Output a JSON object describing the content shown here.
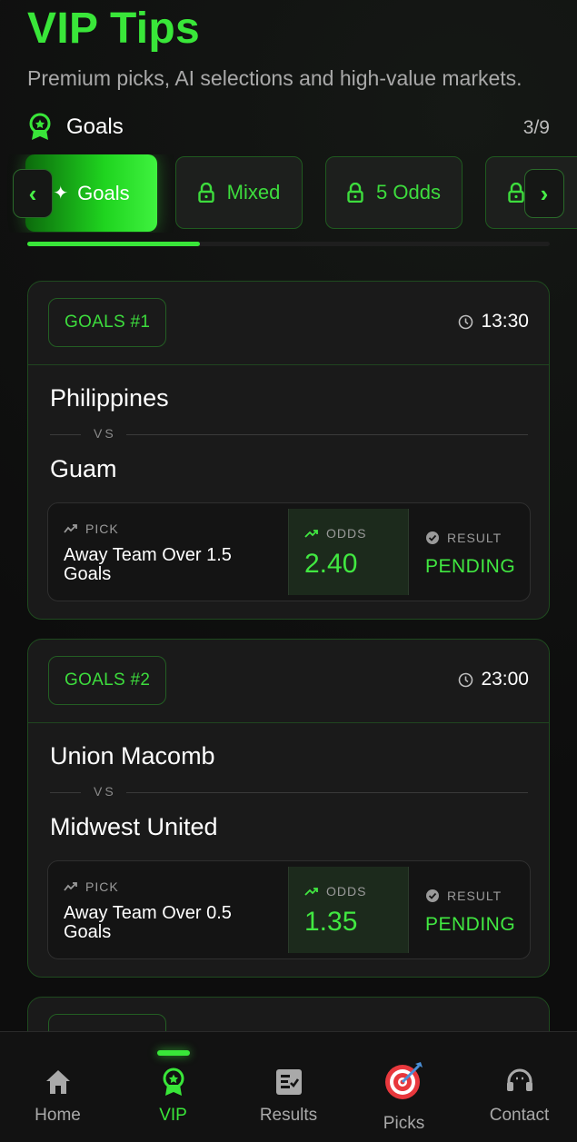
{
  "header": {
    "title": "VIP Tips",
    "subtitle": "Premium picks, AI selections and high-value markets."
  },
  "section": {
    "label": "Goals",
    "count": "3/9",
    "icon": "award-badge-icon"
  },
  "tabs": [
    {
      "label": "Goals",
      "locked": false,
      "active": true
    },
    {
      "label": "Mixed",
      "locked": true,
      "active": false
    },
    {
      "label": "5 Odds",
      "locked": true,
      "active": false
    },
    {
      "label": "",
      "locked": true,
      "active": false
    }
  ],
  "tab_progress": 0.33,
  "cards": [
    {
      "badge": "GOALS #1",
      "time": "13:30",
      "home": "Philippines",
      "vs": "VS",
      "away": "Guam",
      "pick_label": "PICK",
      "pick": "Away Team Over 1.5 Goals",
      "odds_label": "ODDS",
      "odds": "2.40",
      "result_label": "RESULT",
      "result": "PENDING"
    },
    {
      "badge": "GOALS #2",
      "time": "23:00",
      "home": "Union Macomb",
      "vs": "VS",
      "away": "Midwest United",
      "pick_label": "PICK",
      "pick": "Away Team Over 0.5 Goals",
      "odds_label": "ODDS",
      "odds": "1.35",
      "result_label": "RESULT",
      "result": "PENDING"
    }
  ],
  "bottom_nav": [
    {
      "label": "Home",
      "icon": "home-icon",
      "active": false
    },
    {
      "label": "VIP",
      "icon": "award-badge-icon",
      "active": true
    },
    {
      "label": "Results",
      "icon": "results-list-icon",
      "active": false
    },
    {
      "label": "Picks",
      "icon": "target-dart-icon",
      "active": false
    },
    {
      "label": "Contact",
      "icon": "headset-icon",
      "active": false
    }
  ],
  "colors": {
    "accent": "#39e639",
    "background": "#0f0f0f",
    "card": "#1a1a1a"
  }
}
